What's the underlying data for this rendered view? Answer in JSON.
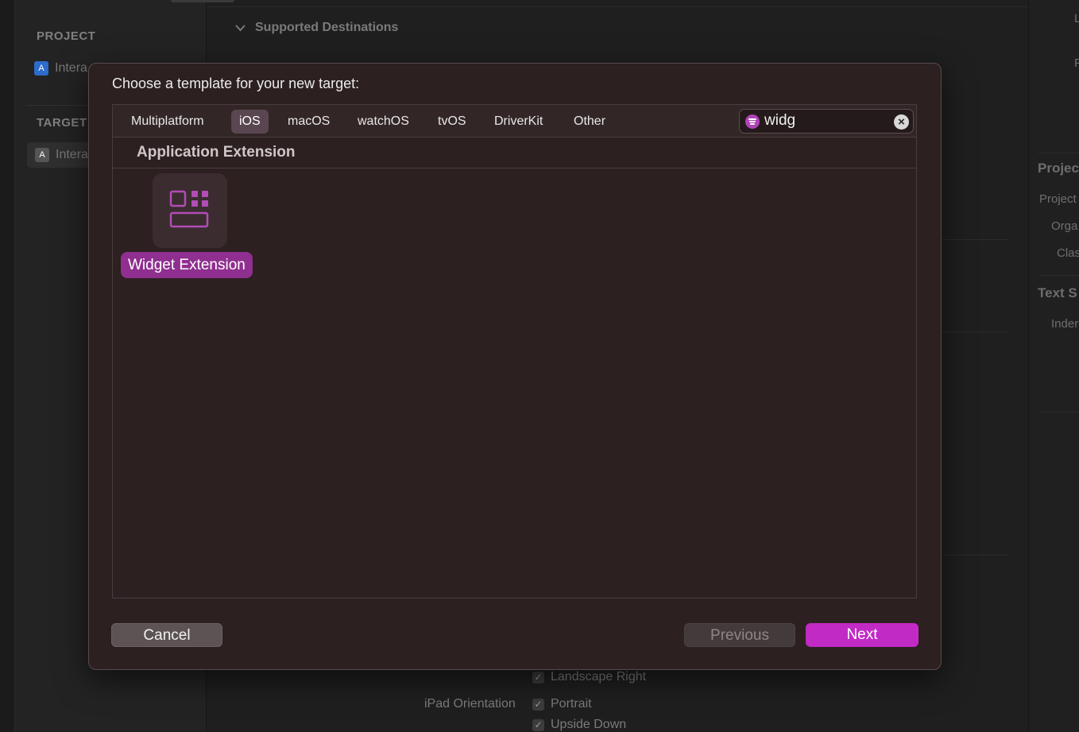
{
  "background": {
    "sidebar": {
      "project_header": "PROJECT",
      "project_item": "Intera",
      "targets_header": "TARGET",
      "target_item": "Intera"
    },
    "main": {
      "section_title": "Supported Destinations",
      "landscape_right": "Landscape Right",
      "ipad_orientation_label": "iPad Orientation",
      "portrait": "Portrait",
      "upside_down": "Upside Down"
    },
    "inspector": {
      "top_fragment_1": "L",
      "top_fragment_2": "F",
      "project_header": "Projec",
      "project_label": "Project",
      "org_label": "Orga",
      "class_label": "Clas",
      "text_settings_header": "Text S",
      "indent_label": "Inder"
    }
  },
  "dialog": {
    "title": "Choose a template for your new target:",
    "tabs": [
      "Multiplatform",
      "iOS",
      "macOS",
      "watchOS",
      "tvOS",
      "DriverKit",
      "Other"
    ],
    "selected_tab": "iOS",
    "search": {
      "value": "widg",
      "icon": "filter-icon",
      "clear_icon": "clear-icon"
    },
    "section_header": "Application Extension",
    "templates": [
      {
        "label": "Widget Extension",
        "icon": "widget-icon",
        "selected": true
      }
    ],
    "buttons": {
      "cancel": "Cancel",
      "previous": "Previous",
      "next": "Next"
    }
  },
  "colors": {
    "accent": "#c22ac6",
    "selection": "#8f2f8f",
    "sheet_background": "#2c2021"
  }
}
